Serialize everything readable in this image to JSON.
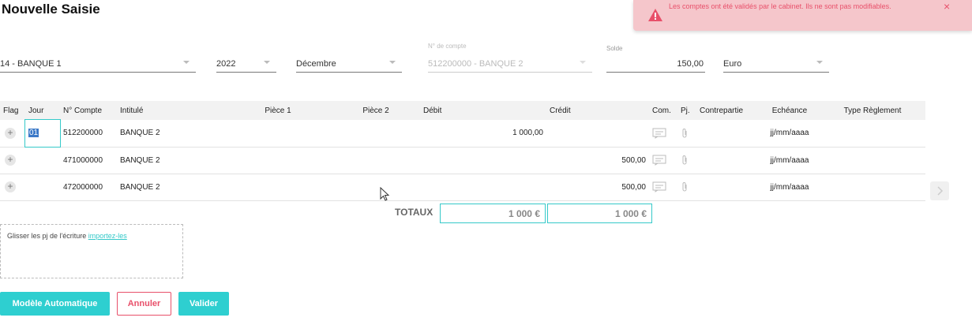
{
  "page": {
    "title": "Nouvelle Saisie"
  },
  "alert": {
    "message": "Les comptes ont été validés par le cabinet. Ils ne sont pas modifiables.",
    "close": "×",
    "icon": "warning-icon",
    "color": "#e8506a",
    "background": "#f5c6cb"
  },
  "filters": {
    "journal": "14 - BANQUE 1",
    "year": "2022",
    "month": "Décembre",
    "account_label": "N° de compte",
    "account": "512200000 - BANQUE 2",
    "solde_label": "Solde",
    "solde": "150,00",
    "currency": "Euro"
  },
  "table": {
    "headers": [
      "Flag",
      "Jour",
      "N° Compte",
      "Intitulé",
      "Pièce 1",
      "Pièce 2",
      "Débit",
      "Crédit",
      "Com.",
      "Pj.",
      "Contrepartie",
      "Echéance",
      "Type Règlement"
    ],
    "rows": [
      {
        "jour": "01",
        "compte": "512200000",
        "intitule": "BANQUE 2",
        "debit": "1 000,00",
        "credit": "",
        "echeance": "jj/mm/aaaa"
      },
      {
        "jour": "",
        "compte": "471000000",
        "intitule": "BANQUE 2",
        "debit": "",
        "credit": "500,00",
        "echeance": "jj/mm/aaaa"
      },
      {
        "jour": "",
        "compte": "472000000",
        "intitule": "BANQUE 2",
        "debit": "",
        "credit": "500,00",
        "echeance": "jj/mm/aaaa"
      }
    ]
  },
  "totals": {
    "label": "TOTAUX",
    "debit": "1 000 €",
    "credit": "1 000 €"
  },
  "dropzone": {
    "text": "Glisser les pj de l'écriture ",
    "link": "importez-les"
  },
  "buttons": {
    "auto": "Modèle Automatique",
    "cancel": "Annuler",
    "validate": "Valider"
  },
  "colors": {
    "accent": "#2ecfd0",
    "danger": "#e8506a"
  }
}
